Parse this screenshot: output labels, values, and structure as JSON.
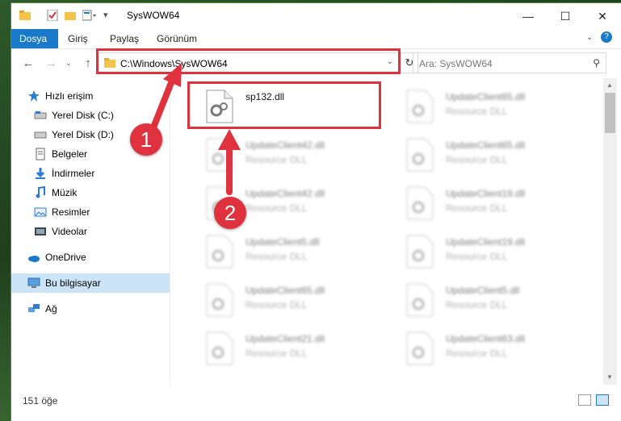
{
  "window": {
    "title": "SysWOW64"
  },
  "ribbon": {
    "tabs": [
      "Dosya",
      "Giriş",
      "Paylaş",
      "Görünüm"
    ]
  },
  "address": {
    "path": "C:\\Windows\\SysWOW64"
  },
  "search": {
    "placeholder": "Ara: SysWOW64"
  },
  "sidebar": {
    "items": [
      {
        "label": "Hızlı erişim",
        "icon": "star-icon"
      },
      {
        "label": "Yerel Disk (C:)",
        "icon": "drive-icon"
      },
      {
        "label": "Yerel Disk (D:)",
        "icon": "drive-icon"
      },
      {
        "label": "Belgeler",
        "icon": "documents-icon"
      },
      {
        "label": "İndirmeler",
        "icon": "download-icon"
      },
      {
        "label": "Müzik",
        "icon": "music-icon"
      },
      {
        "label": "Resimler",
        "icon": "pictures-icon"
      },
      {
        "label": "Videolar",
        "icon": "video-icon"
      },
      {
        "label": "OneDrive",
        "icon": "cloud-icon"
      },
      {
        "label": "Bu bilgisayar",
        "icon": "computer-icon"
      },
      {
        "label": "Ağ",
        "icon": "network-icon"
      }
    ]
  },
  "files": [
    {
      "name": "sp132.dll",
      "type": ""
    },
    {
      "name": "UpdateClient65.dll",
      "type": "Resource DLL"
    },
    {
      "name": "UpdateClient42.dll",
      "type": "Resource DLL"
    },
    {
      "name": "UpdateClient65.dll",
      "type": "Resource DLL"
    },
    {
      "name": "UpdateClient42.dll",
      "type": "Resource DLL"
    },
    {
      "name": "UpdateClient19.dll",
      "type": "Resource DLL"
    },
    {
      "name": "UpdateClient5.dll",
      "type": "Resource DLL"
    },
    {
      "name": "UpdateClient19.dll",
      "type": "Resource DLL"
    },
    {
      "name": "UpdateClient65.dll",
      "type": "Resource DLL"
    },
    {
      "name": "UpdateClient5.dll",
      "type": "Resource DLL"
    },
    {
      "name": "UpdateClient21.dll",
      "type": "Resource DLL"
    },
    {
      "name": "UpdateClient63.dll",
      "type": "Resource DLL"
    }
  ],
  "status": {
    "count": "151 öğe"
  },
  "annotations": {
    "step1": "1",
    "step2": "2"
  },
  "colors": {
    "accent": "#1979ca",
    "highlight": "#e0313f",
    "selected": "#cce4f7"
  }
}
